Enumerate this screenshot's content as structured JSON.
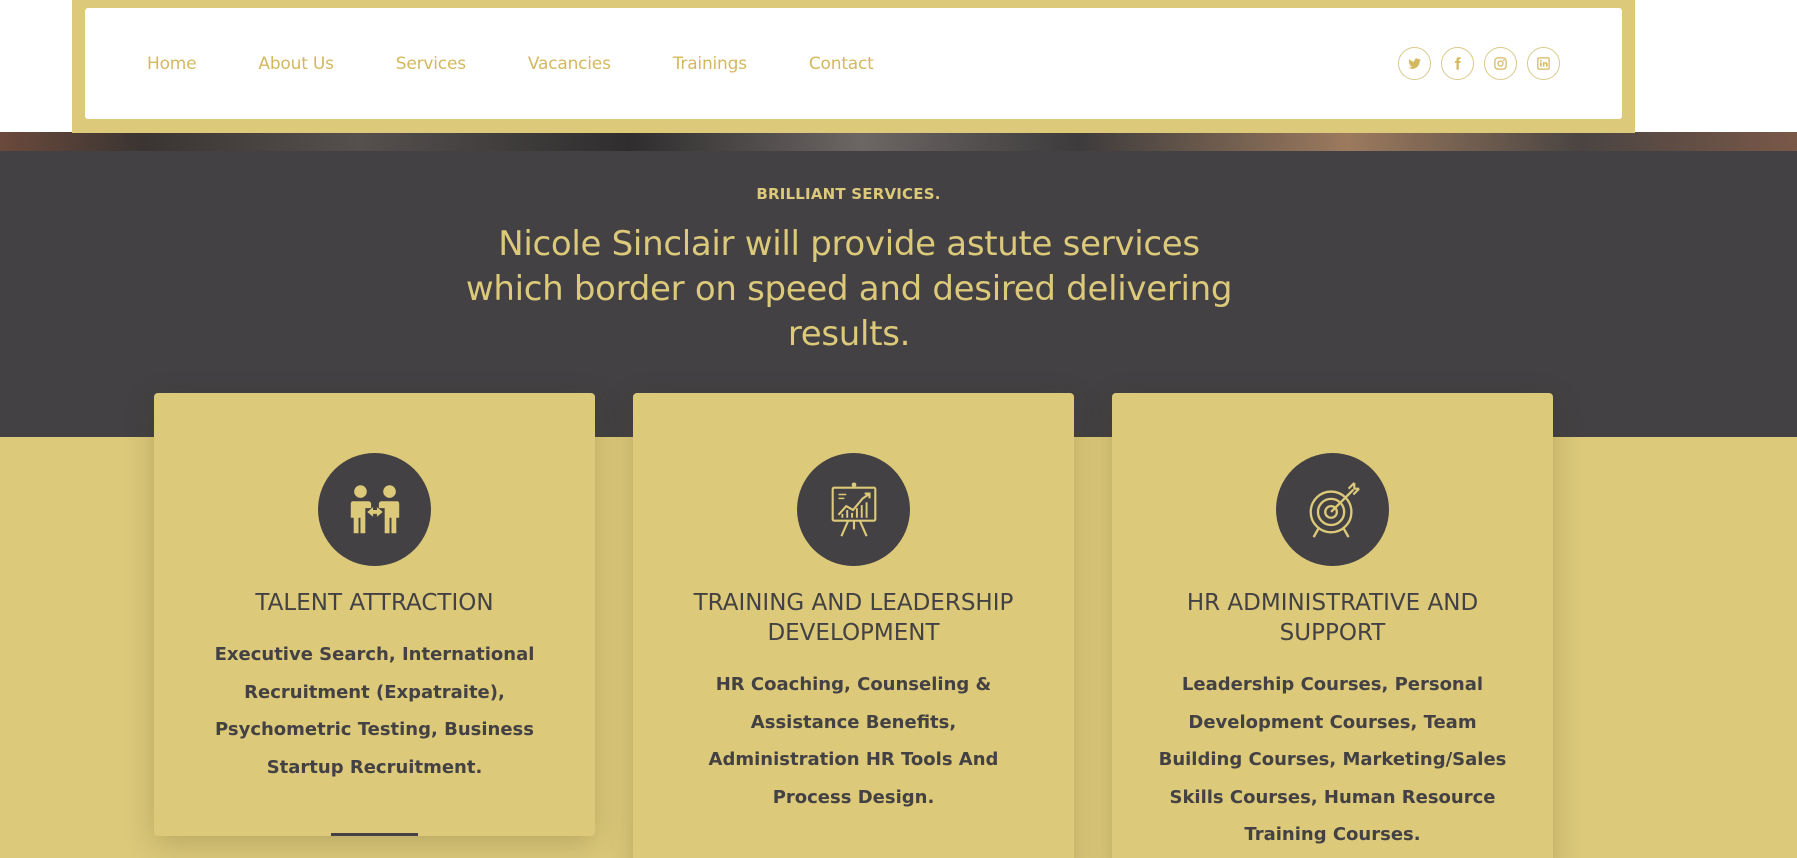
{
  "nav": {
    "items": [
      {
        "label": "Home"
      },
      {
        "label": "About Us"
      },
      {
        "label": "Services"
      },
      {
        "label": "Vacancies"
      },
      {
        "label": "Trainings"
      },
      {
        "label": "Contact"
      }
    ],
    "socials": [
      "twitter-icon",
      "facebook-icon",
      "instagram-icon",
      "linkedin-icon"
    ]
  },
  "hero": {
    "kicker": "BRILLIANT SERVICES.",
    "headline": "Nicole Sinclair will provide astute services which border on speed and desired delivering results."
  },
  "services": [
    {
      "icon": "people-exchange-icon",
      "title": "TALENT ATTRACTION",
      "body": "Executive Search, International Recruitment (Expatraite), Psychometric Testing, Business Startup Recruitment."
    },
    {
      "icon": "presentation-board-icon",
      "title": "TRAINING AND LEADERSHIP DEVELOPMENT",
      "body": "HR Coaching, Counseling & Assistance Benefits, Administration HR Tools And Process Design."
    },
    {
      "icon": "target-icon",
      "title": "HR ADMINISTRATIVE AND SUPPORT",
      "body": "Leadership Courses, Personal Development Courses, Team Building Courses, Marketing/Sales Skills Courses, Human Resource Training Courses."
    }
  ],
  "colors": {
    "accent": "#dcc97a",
    "accent_text": "#d4b85e",
    "dark": "#434143",
    "white": "#ffffff"
  }
}
